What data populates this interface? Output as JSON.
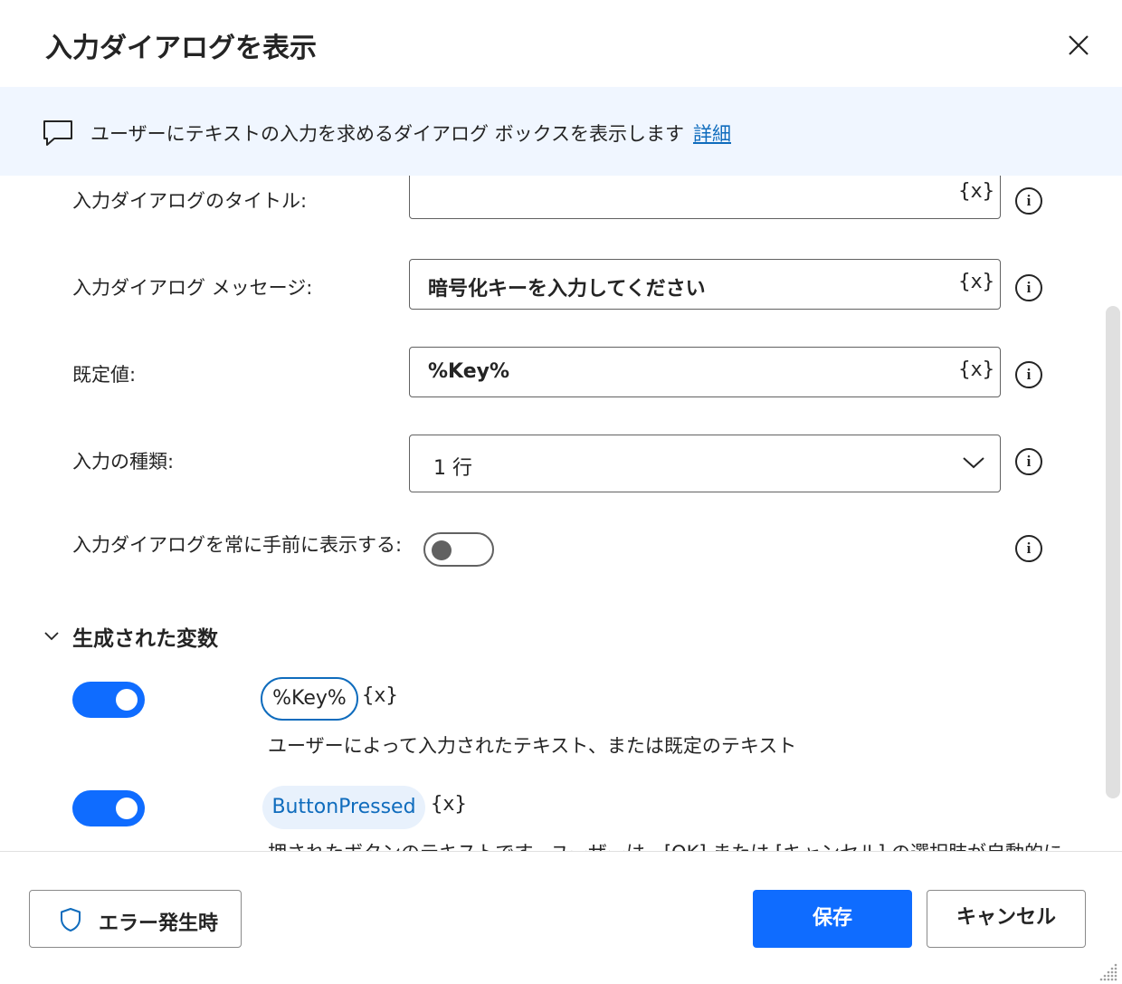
{
  "dialog": {
    "title": "入力ダイアログを表示",
    "close_icon": "close-icon"
  },
  "banner": {
    "icon": "comment-icon",
    "description": "ユーザーにテキストの入力を求めるダイアログ ボックスを表示します",
    "link_label": "詳細"
  },
  "fields": {
    "dialog_title": {
      "label": "入力ダイアログのタイトル:",
      "value": "",
      "var_icon": "{x}"
    },
    "dialog_message": {
      "label": "入力ダイアログ メッセージ:",
      "value": "暗号化キーを入力してください",
      "var_icon": "{x}"
    },
    "default_value": {
      "label": "既定値:",
      "value": "%Key%",
      "var_icon": "{x}"
    },
    "input_type": {
      "label": "入力の種類:",
      "selected": "1 行"
    },
    "always_on_top": {
      "label": "入力ダイアログを常に手前に表示する:",
      "enabled": false
    }
  },
  "generated_variables": {
    "title": "生成された変数",
    "expanded": true,
    "items": [
      {
        "name": "%Key%",
        "var_icon": "{x}",
        "description": "ユーザーによって入力されたテキスト、または既定のテキスト",
        "enabled": true
      },
      {
        "name": "ButtonPressed",
        "var_icon": "{x}",
        "description": "押されたボタンのテキストです。ユーザーは、[OK] または [キャンセル] の選択肢が自動的に",
        "enabled": true
      }
    ]
  },
  "footer": {
    "error_button": "エラー発生時",
    "save_button": "保存",
    "cancel_button": "キャンセル"
  },
  "colors": {
    "accent": "#0f6cff",
    "link": "#0f6cbd",
    "banner_bg": "#f0f6ff"
  }
}
